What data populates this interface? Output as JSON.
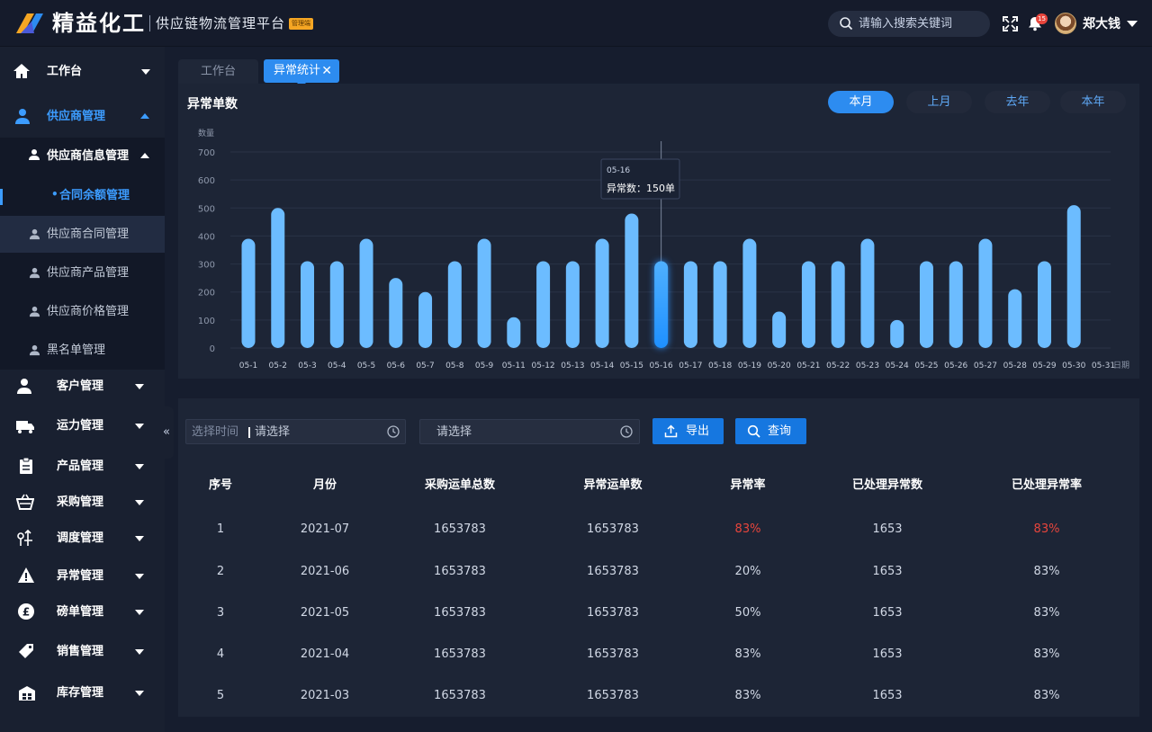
{
  "brand": {
    "name": "精益化工",
    "subtitle": "供应链物流管理平台",
    "badge": "管理端"
  },
  "header": {
    "search_placeholder": "请输入搜索关键词",
    "notification_count": "15",
    "username": "郑大钱"
  },
  "sidebar": {
    "items": [
      {
        "label": "工作台",
        "icon": "home-icon"
      },
      {
        "label": "供应商管理",
        "icon": "supplier-icon"
      },
      {
        "label": "供应商信息管理",
        "icon": "user-icon"
      },
      {
        "label": "合同余额管理"
      },
      {
        "label": "供应商合同管理",
        "icon": "user-icon"
      },
      {
        "label": "供应商产品管理",
        "icon": "user-icon"
      },
      {
        "label": "供应商价格管理",
        "icon": "user-icon"
      },
      {
        "label": "黑名单管理",
        "icon": "user-icon"
      },
      {
        "label": "客户管理",
        "icon": "customer-icon"
      },
      {
        "label": "运力管理",
        "icon": "truck-icon"
      },
      {
        "label": "产品管理",
        "icon": "clipboard-icon"
      },
      {
        "label": "采购管理",
        "icon": "basket-icon"
      },
      {
        "label": "调度管理",
        "icon": "dispatch-icon"
      },
      {
        "label": "异常管理",
        "icon": "warning-icon"
      },
      {
        "label": "磅单管理",
        "icon": "pound-icon"
      },
      {
        "label": "销售管理",
        "icon": "tag-icon"
      },
      {
        "label": "库存管理",
        "icon": "warehouse-icon"
      }
    ],
    "collapse_glyph": "«"
  },
  "tabs": {
    "work": "工作台",
    "active": "异常统计",
    "close_glyph": "✕"
  },
  "chart_panel": {
    "title": "异常单数",
    "ranges": [
      "本月",
      "上月",
      "去年",
      "本年"
    ],
    "selected_range": "本月"
  },
  "chart_data": {
    "type": "bar",
    "ylabel": "数量",
    "xlabel": "日期",
    "ylim": [
      0,
      700
    ],
    "yticks": [
      0,
      100,
      200,
      300,
      400,
      500,
      600,
      700
    ],
    "grid": true,
    "categories": [
      "05-1",
      "05-2",
      "05-3",
      "05-4",
      "05-5",
      "05-6",
      "05-7",
      "05-8",
      "05-9",
      "05-11",
      "05-12",
      "05-13",
      "05-14",
      "05-15",
      "05-16",
      "05-17",
      "05-18",
      "05-19",
      "05-20",
      "05-21",
      "05-22",
      "05-23",
      "05-24",
      "05-25",
      "05-26",
      "05-27",
      "05-28",
      "05-29",
      "05-30",
      "05-31"
    ],
    "values": [
      390,
      500,
      310,
      310,
      390,
      250,
      200,
      310,
      390,
      110,
      310,
      310,
      390,
      480,
      310,
      310,
      310,
      390,
      130,
      310,
      310,
      390,
      100,
      310,
      310,
      390,
      210,
      310,
      510,
      0
    ],
    "highlight_index": 14,
    "tooltip": {
      "date": "05-16",
      "text": "异常数：150单"
    },
    "colors": {
      "bar": "#6cbcff",
      "highlight": "#1e90ff",
      "grid": "#2a3346",
      "axis": "#8e98ab"
    }
  },
  "filters": {
    "time_prefix": "选择时间",
    "time_value": "请选择",
    "second_value": "请选择",
    "export_label": "导出",
    "query_label": "查询"
  },
  "table": {
    "columns": [
      "序号",
      "月份",
      "采购运单总数",
      "异常运单数",
      "异常率",
      "已处理异常数",
      "已处理异常率"
    ],
    "rows": [
      [
        "1",
        "2021-07",
        "1653783",
        "1653783",
        "83%",
        "1653",
        "83%"
      ],
      [
        "2",
        "2021-06",
        "1653783",
        "1653783",
        "20%",
        "1653",
        "83%"
      ],
      [
        "3",
        "2021-05",
        "1653783",
        "1653783",
        "50%",
        "1653",
        "83%"
      ],
      [
        "4",
        "2021-04",
        "1653783",
        "1653783",
        "83%",
        "1653",
        "83%"
      ],
      [
        "5",
        "2021-03",
        "1653783",
        "1653783",
        "83%",
        "1653",
        "83%"
      ]
    ],
    "alert_color": "#e8453c"
  }
}
